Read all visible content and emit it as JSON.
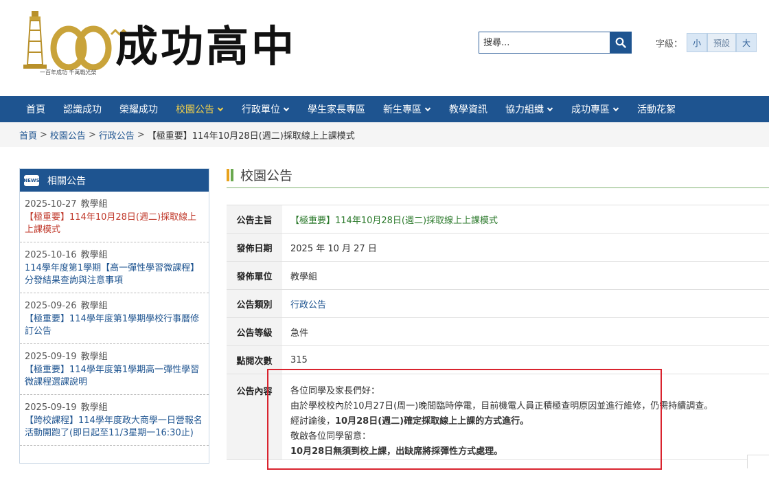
{
  "header": {
    "logo_title": "成功高中",
    "logo_slogan": "一百年成功 千萬戰光榮",
    "search_placeholder": "搜尋...",
    "fontsize_label": "字級：",
    "fontsize_options": [
      "小",
      "預設",
      "大"
    ]
  },
  "nav": {
    "items": [
      {
        "label": "首頁",
        "dropdown": false
      },
      {
        "label": "認識成功",
        "dropdown": false
      },
      {
        "label": "榮耀成功",
        "dropdown": false
      },
      {
        "label": "校園公告",
        "dropdown": true,
        "active": true
      },
      {
        "label": "行政單位",
        "dropdown": true
      },
      {
        "label": "學生家長專區",
        "dropdown": false
      },
      {
        "label": "新生專區",
        "dropdown": true
      },
      {
        "label": "教學資訊",
        "dropdown": false
      },
      {
        "label": "協力組織",
        "dropdown": true
      },
      {
        "label": "成功專區",
        "dropdown": true
      },
      {
        "label": "活動花絮",
        "dropdown": false
      }
    ]
  },
  "breadcrumb": {
    "items": [
      "首頁",
      "校園公告",
      "行政公告"
    ],
    "current": "【極重要】114年10月28日(週二)採取線上上課模式"
  },
  "sidebar": {
    "heading": "相關公告",
    "news_badge": "NEWS",
    "items": [
      {
        "date": "2025-10-27",
        "unit": "教學組",
        "title": "【極重要】114年10月28日(週二)採取線上上課模式"
      },
      {
        "date": "2025-10-16",
        "unit": "教學組",
        "title": "114學年度第1學期【高一彈性學習微課程】分發結果查詢與注意事項"
      },
      {
        "date": "2025-09-26",
        "unit": "教學組",
        "title": "【極重要】114學年度第1學期學校行事曆修訂公告"
      },
      {
        "date": "2025-09-19",
        "unit": "教學組",
        "title": "【極重要】114學年度第1學期高一彈性學習微課程選課說明"
      },
      {
        "date": "2025-09-19",
        "unit": "教學組",
        "title": "【跨校課程】114學年度政大商學一日營報名活動開跑了(即日起至11/3星期一16:30止)"
      }
    ]
  },
  "main": {
    "section_title": "校園公告",
    "rows": [
      {
        "label": "公告主旨",
        "value": "【極重要】114年10月28日(週二)採取線上上課模式"
      },
      {
        "label": "發佈日期",
        "value": "2025 年 10 月 27 日"
      },
      {
        "label": "發佈單位",
        "value": "教學組"
      },
      {
        "label": "公告類別",
        "value": "行政公告"
      },
      {
        "label": "公告等級",
        "value": "急件"
      },
      {
        "label": "點閱次數",
        "value": "315"
      }
    ],
    "content_label": "公告內容",
    "content": {
      "line1": "各位同學及家長們好：",
      "line2": "由於學校校內於10月27日(周一)晚間臨時停電，目前機電人員正積極查明原因並進行維修，仍需持續調查。",
      "line3_pre": "經討論後，",
      "line3_bold": "10月28日(週二)確定採取線上上課的方式進行。",
      "line4": "敬啟各位同學留意：",
      "line5_bold": "10月28日無須到校上課，出缺席將採彈性方式處理。"
    }
  },
  "colors": {
    "nav_bg": "#1e5490",
    "active_nav": "#f5d24a",
    "highlight_border": "#d9232e",
    "subject_green": "#2c7a2c"
  }
}
